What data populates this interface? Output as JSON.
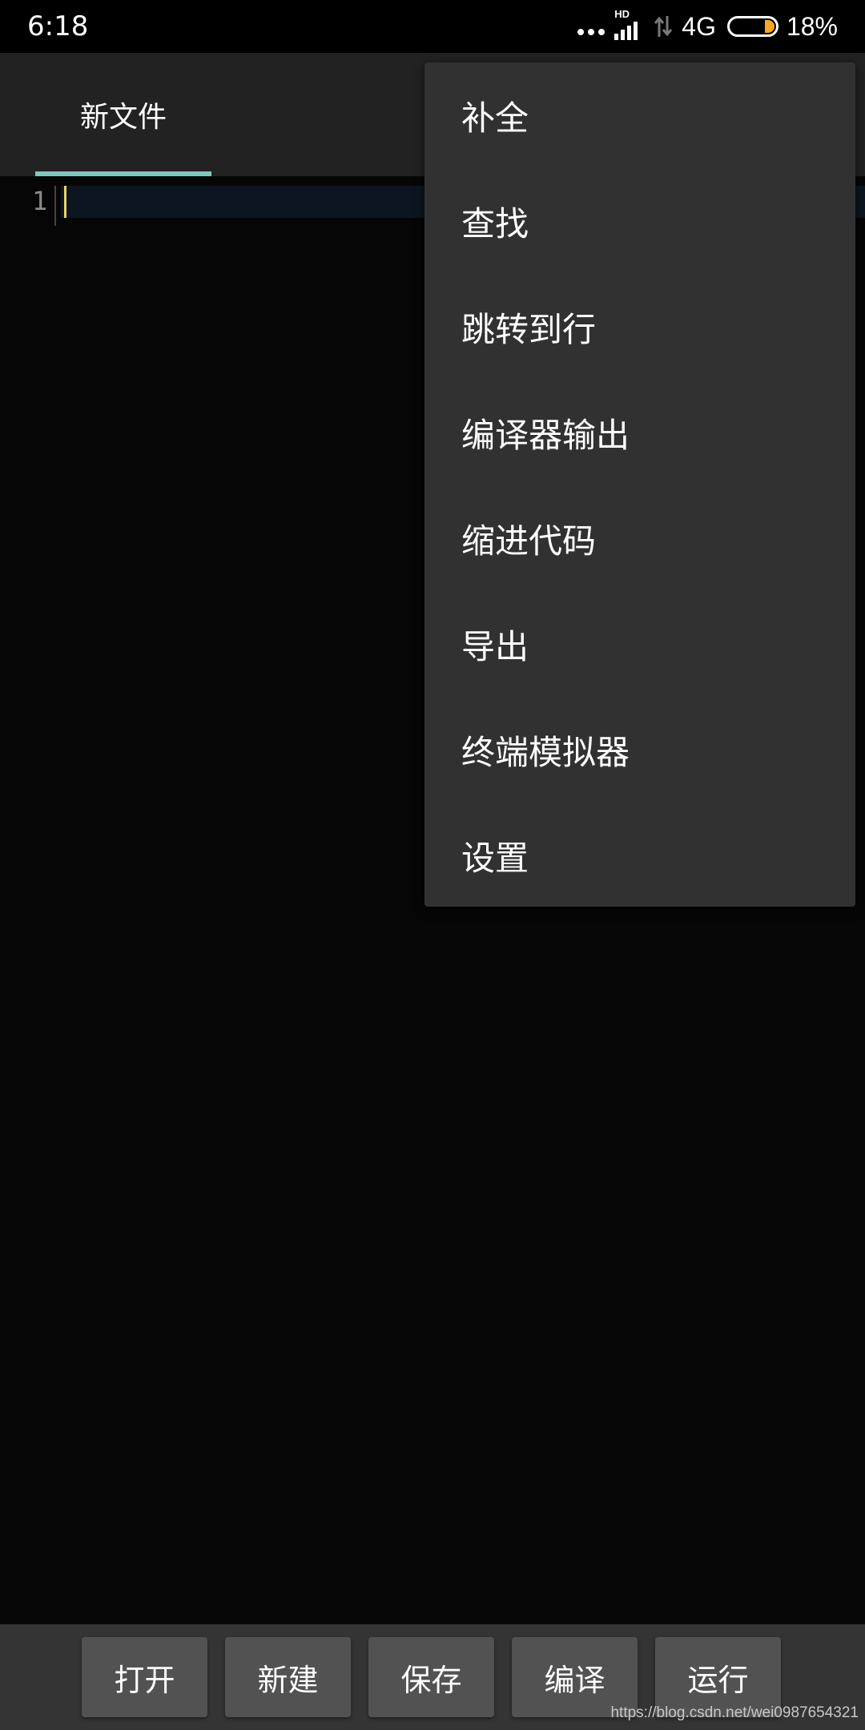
{
  "status_bar": {
    "time": "6:18",
    "network": "4G",
    "battery": "18%",
    "battery_level": 0.18,
    "hd_label": "HD",
    "icons": [
      "more-dots-icon",
      "signal-icon",
      "data-arrows-icon",
      "battery-icon"
    ],
    "battery_color": "#f5a623"
  },
  "toolbar": {
    "tab_label": "新文件",
    "accent_color": "#7ec9bc"
  },
  "editor": {
    "line_number": "1",
    "cursor_color": "#e8d36a"
  },
  "menu": {
    "items": [
      "补全",
      "查找",
      "跳转到行",
      "编译器输出",
      "缩进代码",
      "导出",
      "终端模拟器",
      "设置"
    ]
  },
  "bottom_bar": {
    "buttons": [
      "打开",
      "新建",
      "保存",
      "编译",
      "运行"
    ]
  },
  "watermark": "https://blog.csdn.net/wei0987654321"
}
